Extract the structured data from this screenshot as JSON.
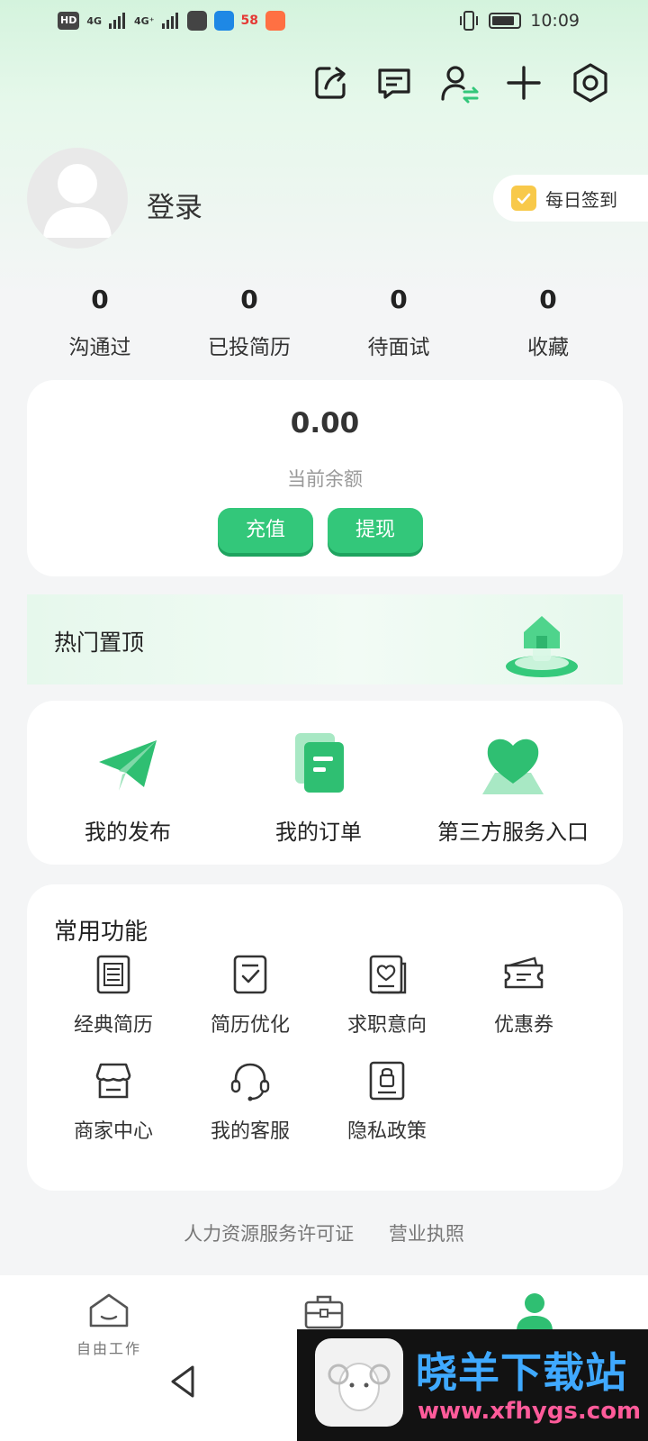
{
  "status_bar": {
    "hd": "HD",
    "net1": "4G",
    "net2": "4G⁺",
    "app_badge": "58",
    "time": "10:09"
  },
  "header": {
    "icons": [
      "share-icon",
      "message-icon",
      "switch-identity-icon",
      "add-icon",
      "settings-icon"
    ]
  },
  "profile": {
    "login_label": "登录",
    "checkin_label": "每日签到"
  },
  "stats": [
    {
      "value": "0",
      "label": "沟通过"
    },
    {
      "value": "0",
      "label": "已投简历"
    },
    {
      "value": "0",
      "label": "待面试"
    },
    {
      "value": "0",
      "label": "收藏"
    }
  ],
  "balance": {
    "value": "0.00",
    "label": "当前余额",
    "recharge_label": "充值",
    "withdraw_label": "提现"
  },
  "hot": {
    "title": "热门置顶"
  },
  "services": [
    {
      "label": "我的发布",
      "icon": "paper-plane-icon"
    },
    {
      "label": "我的订单",
      "icon": "order-doc-icon"
    },
    {
      "label": "第三方服务入口",
      "icon": "heart-icon"
    }
  ],
  "functions": {
    "title": "常用功能",
    "items": [
      {
        "label": "经典简历",
        "icon": "resume-icon"
      },
      {
        "label": "简历优化",
        "icon": "optimize-icon"
      },
      {
        "label": "求职意向",
        "icon": "intention-icon"
      },
      {
        "label": "优惠券",
        "icon": "coupon-icon"
      },
      {
        "label": "商家中心",
        "icon": "store-icon"
      },
      {
        "label": "我的客服",
        "icon": "headset-icon"
      },
      {
        "label": "隐私政策",
        "icon": "privacy-icon"
      }
    ]
  },
  "footer": {
    "license_label": "人力资源服务许可证",
    "business_label": "营业执照"
  },
  "tabbar": {
    "home_label": "自由工作"
  },
  "watermark": {
    "title": "晓羊下载站",
    "url": "www.xfhygs.com"
  },
  "colors": {
    "accent": "#33c77a",
    "accent_dark": "#1fa35f"
  }
}
